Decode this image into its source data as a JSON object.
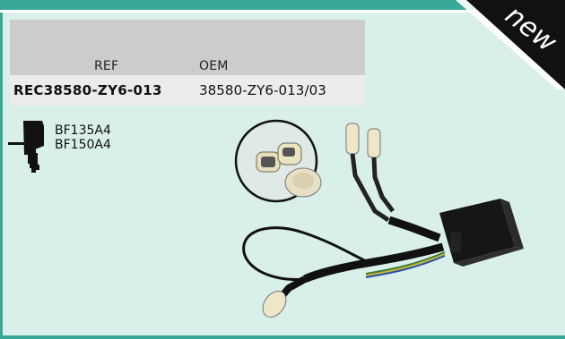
{
  "table": {
    "ref_header": "REF",
    "oem_header": "OEM",
    "ref_value": "REC38580-ZY6-013",
    "oem_value": "38580-ZY6-013/03"
  },
  "engine_models": [
    "BF135A4",
    "BF150A4"
  ],
  "badge": {
    "label": "new"
  },
  "colors": {
    "background": "#d9efe9",
    "accent_bar": "#3aa898",
    "table_header": "#cccccc",
    "table_row": "#ececec",
    "badge": "#111111"
  },
  "icons": {
    "engine": "outboard-engine-icon",
    "product": "wiring-harness-photo"
  }
}
